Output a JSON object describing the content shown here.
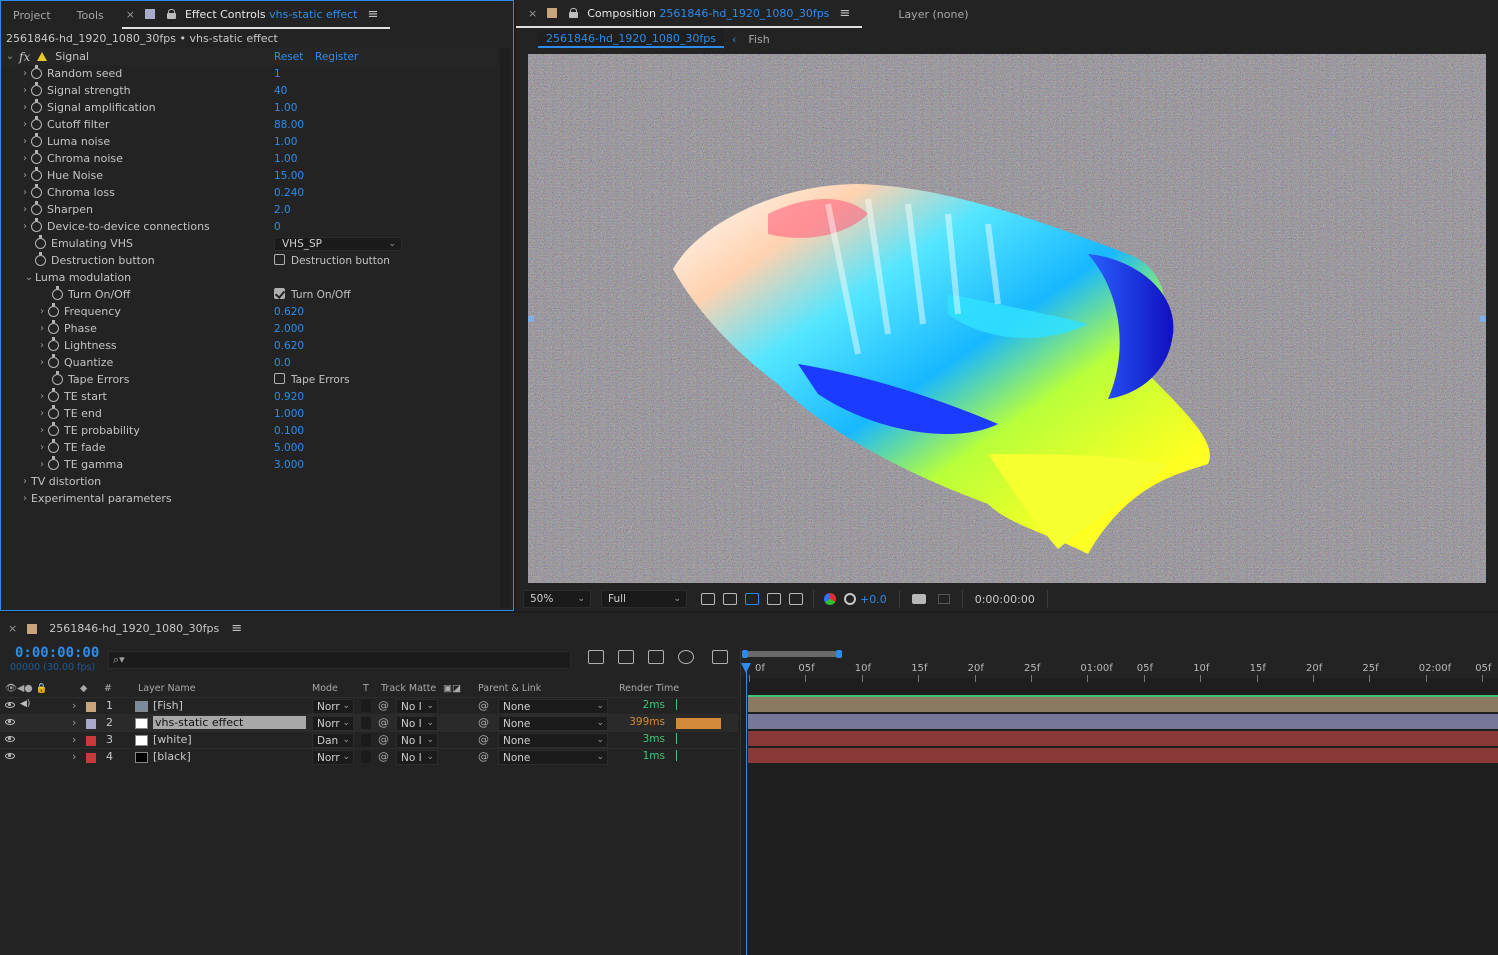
{
  "effect_panel": {
    "tabs": {
      "project": "Project",
      "tools": "Tools",
      "effect_controls_prefix": "Effect Controls",
      "effect_controls_name": "vhs-static effect"
    },
    "subtitle": "2561846-hd_1920_1080_30fps • vhs-static effect",
    "effect_name": "Signal",
    "reset": "Reset",
    "register": "Register",
    "params": [
      {
        "name": "Random seed",
        "value": "1"
      },
      {
        "name": "Signal strength",
        "value": "40"
      },
      {
        "name": "Signal amplification",
        "value": "1.00"
      },
      {
        "name": "Cutoff filter",
        "value": "88.00"
      },
      {
        "name": "Luma noise",
        "value": "1.00"
      },
      {
        "name": "Chroma noise",
        "value": "1.00"
      },
      {
        "name": "Hue Noise",
        "value": "15.00"
      },
      {
        "name": "Chroma loss",
        "value": "0.240"
      },
      {
        "name": "Sharpen",
        "value": "2.0"
      },
      {
        "name": "Device-to-device connections",
        "value": "0"
      }
    ],
    "emulating": {
      "name": "Emulating VHS",
      "value": "VHS_SP"
    },
    "destruction": {
      "name": "Destruction button",
      "checkbox_label": "Destruction button"
    },
    "luma_group": "Luma modulation",
    "luma_toggle": {
      "name": "Turn On/Off",
      "checkbox_label": "Turn On/Off"
    },
    "luma_params": [
      {
        "name": "Frequency",
        "value": "0.620"
      },
      {
        "name": "Phase",
        "value": "2.000"
      },
      {
        "name": "Lightness",
        "value": "0.620"
      },
      {
        "name": "Quantize",
        "value": "0.0"
      }
    ],
    "tape_errors": {
      "name": "Tape Errors",
      "checkbox_label": "Tape Errors"
    },
    "te_params": [
      {
        "name": "TE start",
        "value": "0.920"
      },
      {
        "name": "TE end",
        "value": "1.000"
      },
      {
        "name": "TE probability",
        "value": "0.100"
      },
      {
        "name": "TE fade",
        "value": "5.000"
      },
      {
        "name": "TE gamma",
        "value": "3.000"
      }
    ],
    "groups_bottom": [
      "TV distortion",
      "Experimental parameters"
    ]
  },
  "composition_panel": {
    "tab_prefix": "Composition",
    "tab_name": "2561846-hd_1920_1080_30fps",
    "layer_tab": "Layer  (none)",
    "breadcrumb_comp": "2561846-hd_1920_1080_30fps",
    "breadcrumb_layer": "Fish",
    "zoom": "50%",
    "resolution": "Full",
    "exposure": "+0.0",
    "timecode": "0:00:00:00"
  },
  "timeline": {
    "tab_name": "2561846-hd_1920_1080_30fps",
    "current_time": "0:00:00:00",
    "frames": "00000 (30.00 fps)",
    "search_placeholder": "⌕▾",
    "headers": {
      "num": "#",
      "layer_name": "Layer Name",
      "mode": "Mode",
      "t": "T",
      "track_matte": "Track Matte",
      "parent": "Parent & Link",
      "render_time": "Render Time"
    },
    "ruler": [
      "0f",
      "05f",
      "10f",
      "15f",
      "20f",
      "25f",
      "01:00f",
      "05f",
      "10f",
      "15f",
      "20f",
      "25f",
      "02:00f",
      "05f"
    ],
    "layers": [
      {
        "num": "1",
        "name": "[Fish]",
        "mode": "Norr",
        "matte": "No I",
        "parent": "None",
        "render": "2ms",
        "label_color": "#c9a37a",
        "bar_color": "#8a7a62"
      },
      {
        "num": "2",
        "name": "vhs-static effect",
        "mode": "Norr",
        "matte": "No I",
        "parent": "None",
        "render": "399ms",
        "label_color": "#a9a9c9",
        "bar_color": "#77779a"
      },
      {
        "num": "3",
        "name": "[white]",
        "mode": "Dan",
        "matte": "No I",
        "parent": "None",
        "render": "3ms",
        "label_color": "#c83a3a",
        "bar_color": "#8a3838"
      },
      {
        "num": "4",
        "name": "[black]",
        "mode": "Norr",
        "matte": "No I",
        "parent": "None",
        "render": "1ms",
        "label_color": "#c83a3a",
        "bar_color": "#8a3838"
      }
    ]
  }
}
